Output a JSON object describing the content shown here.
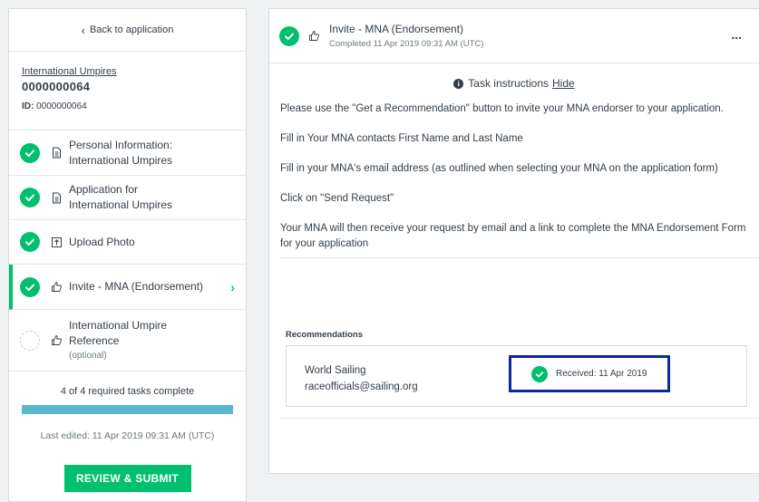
{
  "sidebar": {
    "back_label": "Back to application",
    "app_name": "International Umpires",
    "app_number": "0000000064",
    "id_label": "ID:",
    "id_value": "0000000064",
    "tasks": [
      {
        "label_line1": "Personal Information:",
        "label_line2": "International Umpires",
        "icon": "document-icon",
        "status": "complete"
      },
      {
        "label_line1": "Application for",
        "label_line2": "International Umpires",
        "icon": "document-icon",
        "status": "complete"
      },
      {
        "label_line1": "Upload Photo",
        "icon": "upload-icon",
        "status": "complete"
      },
      {
        "label_line1": "Invite - MNA (Endorsement)",
        "icon": "thumbs-up-icon",
        "status": "complete",
        "active": true
      },
      {
        "label_line1": "International Umpire",
        "label_line2": "Reference",
        "optional": "(optional)",
        "icon": "thumbs-up-icon",
        "status": "incomplete"
      }
    ],
    "progress_text": "4 of 4 required tasks complete",
    "progress_fraction": 1.0,
    "last_edited": "Last edited: 11 Apr 2019 09:31 AM (UTC)",
    "review_button": "REVIEW & SUBMIT"
  },
  "main": {
    "title": "Invite - MNA (Endorsement)",
    "subtitle": "Completed 11 Apr 2019 09:31 AM (UTC)",
    "more_label": "...",
    "instructions_heading": "Task instructions",
    "hide_label": "Hide",
    "instructions": [
      "Please use the \"Get a Recommendation\" button to invite your MNA endorser to your application.",
      "Fill in Your MNA contacts First Name and Last Name",
      "Fill in your MNA's email address (as outlined when selecting your MNA on the application form)",
      "Click on \"Send Request\"",
      "Your MNA will then receive your request by email and  a link to complete the MNA Endorsement Form for your application"
    ],
    "recommendations_label": "Recommendations",
    "recommendation": {
      "name": "World Sailing",
      "email": "raceofficials@sailing.org",
      "status": "Received: 11 Apr 2019"
    }
  },
  "colors": {
    "accent_green": "#00bf6f",
    "progress_blue": "#58b6ce",
    "highlight_border": "#0b2aa0"
  }
}
